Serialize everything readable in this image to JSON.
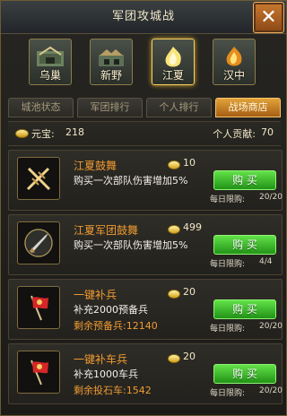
{
  "window": {
    "title": "军团攻城战",
    "close_icon": "close-x-icon"
  },
  "cities": [
    {
      "name": "乌巢",
      "icon": "camp-icon",
      "selected": false
    },
    {
      "name": "新野",
      "icon": "village-icon",
      "selected": false
    },
    {
      "name": "江夏",
      "icon": "fire-icon",
      "selected": true
    },
    {
      "name": "汉中",
      "icon": "flame-icon",
      "selected": false
    }
  ],
  "tabs": [
    {
      "label": "城池状态",
      "active": false
    },
    {
      "label": "军团排行",
      "active": false
    },
    {
      "label": "个人排行",
      "active": false
    },
    {
      "label": "战场商店",
      "active": true
    }
  ],
  "summary": {
    "yuanbao_label": "元宝:",
    "yuanbao_value": "218",
    "contribution_label": "个人贡献:",
    "contribution_value": "70"
  },
  "items": [
    {
      "name": "江夏鼓舞",
      "price": "10",
      "description": "购买一次部队伤害增加5%",
      "remaining": "",
      "button_label": "购 买",
      "limit_label": "每日限购:",
      "limit_value": "20/20",
      "icon": "crossed-swords-icon"
    },
    {
      "name": "江夏军团鼓舞",
      "price": "499",
      "description": "购买一次部队伤害增加5%",
      "remaining": "",
      "button_label": "购 买",
      "limit_label": "每日限购:",
      "limit_value": "4/4",
      "icon": "blade-emblem-icon"
    },
    {
      "name": "一键补兵",
      "price": "20",
      "description": "补充2000预备兵",
      "remaining": "剩余预备兵:12140",
      "button_label": "购 买",
      "limit_label": "每日限购:",
      "limit_value": "20/20",
      "icon": "red-flag-icon"
    },
    {
      "name": "一键补车兵",
      "price": "20",
      "description": "补充1000车兵",
      "remaining": "剩余投石车:1542",
      "button_label": "购 买",
      "limit_label": "每日限购:",
      "limit_value": "20/20",
      "icon": "red-flag-icon"
    }
  ],
  "colors": {
    "accent": "#e1a33a",
    "buy_button": "#4fcf3a",
    "item_name": "#f09b32"
  }
}
